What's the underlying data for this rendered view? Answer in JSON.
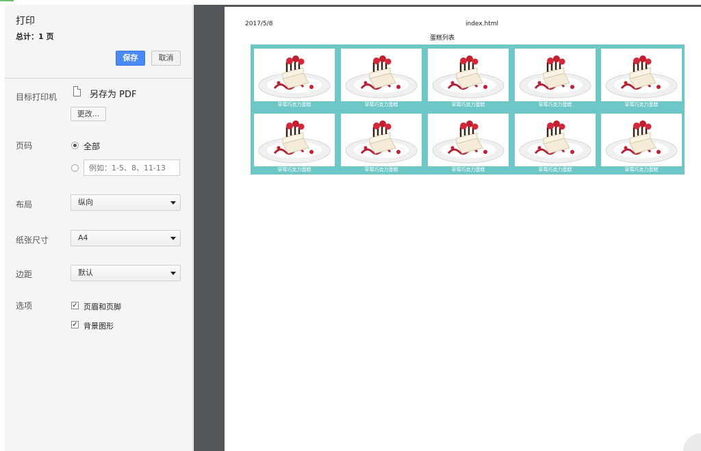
{
  "dialog": {
    "title": "打印",
    "total": "总计：1 页",
    "save_label": "保存",
    "cancel_label": "取消"
  },
  "destination": {
    "label": "目标打印机",
    "value": "另存为 PDF",
    "change_label": "更改..."
  },
  "pages": {
    "label": "页码",
    "all_label": "全部",
    "custom_placeholder": "例如：1-5、8、11-13"
  },
  "layout": {
    "label": "布局",
    "value": "纵向"
  },
  "paper": {
    "label": "纸张尺寸",
    "value": "A4"
  },
  "margins": {
    "label": "边距",
    "value": "默认"
  },
  "options": {
    "label": "选项",
    "headers_footers": "页眉和页脚",
    "background_graphics": "背景图形"
  },
  "preview": {
    "date": "2017/5/8",
    "filename": "index.html",
    "heading": "蛋糕列表",
    "cards": [
      "草莓巧克力蛋糕",
      "草莓巧克力蛋糕",
      "草莓巧克力蛋糕",
      "草莓巧克力蛋糕",
      "草莓巧克力蛋糕",
      "草莓巧克力蛋糕",
      "草莓巧克力蛋糕",
      "草莓巧克力蛋糕",
      "草莓巧克力蛋糕",
      "草莓巧克力蛋糕"
    ],
    "card_bg": "#6dc7c7"
  }
}
